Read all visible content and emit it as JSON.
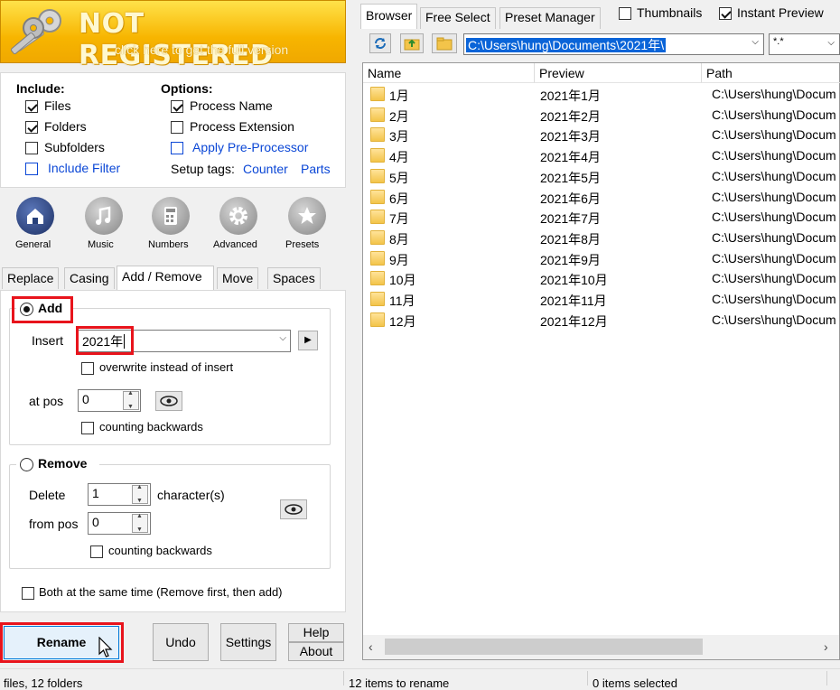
{
  "banner": {
    "title": "NOT REGISTERED",
    "subtitle": "click here to get the full version",
    "color": "#f7b500"
  },
  "include": {
    "heading": "Include:",
    "files": {
      "label": "Files",
      "checked": true
    },
    "folders": {
      "label": "Folders",
      "checked": true
    },
    "subfolders": {
      "label": "Subfolders",
      "checked": false
    },
    "include_filter": {
      "label": "Include Filter",
      "checked": false
    }
  },
  "options": {
    "heading": "Options:",
    "process_name": {
      "label": "Process Name",
      "checked": true
    },
    "process_extension": {
      "label": "Process Extension",
      "checked": false
    },
    "pre_processor": {
      "label": "Apply Pre-Processor",
      "checked": false
    },
    "setup_tags_label": "Setup tags:",
    "counter_link": "Counter",
    "parts_link": "Parts"
  },
  "categories": [
    {
      "label": "General",
      "icon": "home-icon",
      "color": "#27407a"
    },
    {
      "label": "Music",
      "icon": "music-note-icon",
      "color": "#8a8a8a"
    },
    {
      "label": "Numbers",
      "icon": "calculator-icon",
      "color": "#8a8a8a"
    },
    {
      "label": "Advanced",
      "icon": "gear-icon",
      "color": "#8a8a8a"
    },
    {
      "label": "Presets",
      "icon": "star-icon",
      "color": "#8a8a8a"
    }
  ],
  "tabs": [
    "Replace",
    "Casing",
    "Add / Remove",
    "Move",
    "Spaces"
  ],
  "active_tab": "Add / Remove",
  "add": {
    "label": "Add",
    "selected": true,
    "insert_label": "Insert",
    "insert_value": "2021年",
    "overwrite_label": "overwrite instead of insert",
    "at_pos_label": "at pos",
    "at_pos_value": "0",
    "counting_backwards_label": "counting backwards"
  },
  "remove": {
    "label": "Remove",
    "selected": false,
    "delete_label": "Delete",
    "delete_value": "1",
    "characters_label": "character(s)",
    "from_pos_label": "from pos",
    "from_pos_value": "0",
    "counting_backwards_label": "counting backwards"
  },
  "both_at_same_time": "Both at the same time (Remove first, then add)",
  "buttons": {
    "rename": "Rename",
    "undo": "Undo",
    "settings": "Settings",
    "help": "Help",
    "about": "About"
  },
  "browser": {
    "tabs": [
      "Browser",
      "Free Select",
      "Preset Manager"
    ],
    "thumbnails": {
      "label": "Thumbnails",
      "checked": false
    },
    "instant_preview": {
      "label": "Instant Preview",
      "checked": true
    },
    "path": "C:\\Users\\hung\\Documents\\2021年\\",
    "filter": "*.*"
  },
  "list": {
    "columns": [
      "Name",
      "Preview",
      "Path"
    ],
    "rows": [
      {
        "name": "1月",
        "preview": "2021年1月",
        "path": "C:\\Users\\hung\\Docum"
      },
      {
        "name": "2月",
        "preview": "2021年2月",
        "path": "C:\\Users\\hung\\Docum"
      },
      {
        "name": "3月",
        "preview": "2021年3月",
        "path": "C:\\Users\\hung\\Docum"
      },
      {
        "name": "4月",
        "preview": "2021年4月",
        "path": "C:\\Users\\hung\\Docum"
      },
      {
        "name": "5月",
        "preview": "2021年5月",
        "path": "C:\\Users\\hung\\Docum"
      },
      {
        "name": "6月",
        "preview": "2021年6月",
        "path": "C:\\Users\\hung\\Docum"
      },
      {
        "name": "7月",
        "preview": "2021年7月",
        "path": "C:\\Users\\hung\\Docum"
      },
      {
        "name": "8月",
        "preview": "2021年8月",
        "path": "C:\\Users\\hung\\Docum"
      },
      {
        "name": "9月",
        "preview": "2021年9月",
        "path": "C:\\Users\\hung\\Docum"
      },
      {
        "name": "10月",
        "preview": "2021年10月",
        "path": "C:\\Users\\hung\\Docum"
      },
      {
        "name": "11月",
        "preview": "2021年11月",
        "path": "C:\\Users\\hung\\Docum"
      },
      {
        "name": "12月",
        "preview": "2021年12月",
        "path": "C:\\Users\\hung\\Docum"
      }
    ]
  },
  "status": {
    "left": "files, 12 folders",
    "middle": "12 items to rename",
    "right": "0 items selected"
  },
  "colors": {
    "highlight": "#e8141c",
    "link": "#0b47d6",
    "path_selection": "#0a64d8"
  }
}
